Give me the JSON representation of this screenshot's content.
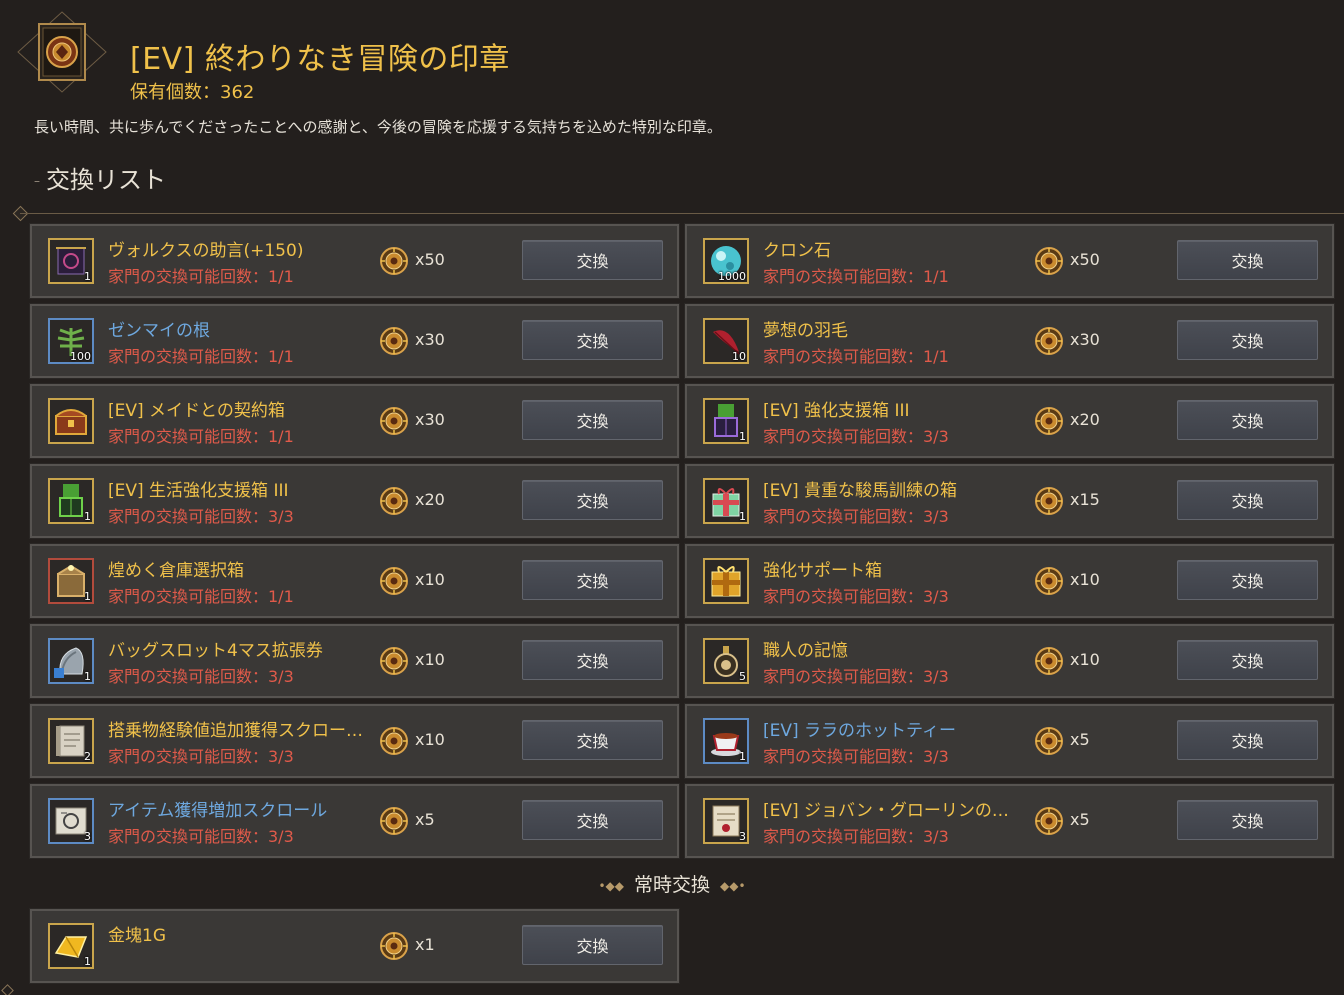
{
  "header": {
    "title": "[EV] 終わりなき冒険の印章",
    "owned_label": "保有個数：362",
    "description": "長い時間、共に歩んでくださったことへの感謝と、今後の冒険を応援する気持ちを込めた特別な印章。",
    "section_title": "交換リスト",
    "section_dash": "–"
  },
  "items": [
    {
      "name": "ヴォルクスの助言(+150)",
      "limit": "家門の交換可能回数：1/1",
      "cost": "x50",
      "qty": "1",
      "button": "交換",
      "icon": "scroll-icon",
      "name_color": "gold"
    },
    {
      "name": "クロン石",
      "limit": "家門の交換可能回数：1/1",
      "cost": "x50",
      "qty": "1000",
      "button": "交換",
      "icon": "cron-stone-icon",
      "name_color": "gold"
    },
    {
      "name": "ゼンマイの根",
      "limit": "家門の交換可能回数：1/1",
      "cost": "x30",
      "qty": "100",
      "button": "交換",
      "icon": "fern-root-icon",
      "name_color": "blue"
    },
    {
      "name": "夢想の羽毛",
      "limit": "家門の交換可能回数：1/1",
      "cost": "x30",
      "qty": "10",
      "button": "交換",
      "icon": "feather-icon",
      "name_color": "gold"
    },
    {
      "name": "[EV] メイドとの契約箱",
      "limit": "家門の交換可能回数：1/1",
      "cost": "x30",
      "qty": "",
      "button": "交換",
      "icon": "chest-icon",
      "name_color": "gold"
    },
    {
      "name": "[EV] 強化支援箱 III",
      "limit": "家門の交換可能回数：3/3",
      "cost": "x20",
      "qty": "1",
      "button": "交換",
      "icon": "purple-box-icon",
      "name_color": "gold"
    },
    {
      "name": "[EV] 生活強化支援箱 III",
      "limit": "家門の交換可能回数：3/3",
      "cost": "x20",
      "qty": "1",
      "button": "交換",
      "icon": "green-box-icon",
      "name_color": "gold"
    },
    {
      "name": "[EV] 貴重な駿馬訓練の箱",
      "limit": "家門の交換可能回数：3/3",
      "cost": "x15",
      "qty": "1",
      "button": "交換",
      "icon": "gift-box-icon",
      "name_color": "gold"
    },
    {
      "name": "煌めく倉庫選択箱",
      "limit": "家門の交換可能回数：1/1",
      "cost": "x10",
      "qty": "1",
      "button": "交換",
      "icon": "storage-box-icon",
      "name_color": "gold"
    },
    {
      "name": "強化サポート箱",
      "limit": "家門の交換可能回数：3/3",
      "cost": "x10",
      "qty": "",
      "button": "交換",
      "icon": "gold-gift-icon",
      "name_color": "gold"
    },
    {
      "name": "バッグスロット4マス拡張券",
      "limit": "家門の交換可能回数：3/3",
      "cost": "x10",
      "qty": "1",
      "button": "交換",
      "icon": "bag-icon",
      "name_color": "gold"
    },
    {
      "name": "職人の記憶",
      "limit": "家門の交換可能回数：3/3",
      "cost": "x10",
      "qty": "5",
      "button": "交換",
      "icon": "bottle-icon",
      "name_color": "gold"
    },
    {
      "name": "搭乗物経験値追加獲得スクロー…",
      "limit": "家門の交換可能回数：3/3",
      "cost": "x10",
      "qty": "2",
      "button": "交換",
      "icon": "mount-scroll-icon",
      "name_color": "gold"
    },
    {
      "name": "[EV] ララのホットティー",
      "limit": "家門の交換可能回数：3/3",
      "cost": "x5",
      "qty": "1",
      "button": "交換",
      "icon": "tea-cup-icon",
      "name_color": "blue"
    },
    {
      "name": "アイテム獲得増加スクロール",
      "limit": "家門の交換可能回数：3/3",
      "cost": "x5",
      "qty": "3",
      "button": "交換",
      "icon": "item-scroll-icon",
      "name_color": "blue"
    },
    {
      "name": "[EV] ジョバン・グローリンの…",
      "limit": "家門の交換可能回数：3/3",
      "cost": "x5",
      "qty": "3",
      "button": "交換",
      "icon": "letter-icon",
      "name_color": "gold"
    }
  ],
  "always_section": {
    "title": "常時交換",
    "orn_left": "•◆◆",
    "orn_right": "◆◆•"
  },
  "always_items": [
    {
      "name": "金塊1G",
      "limit": "",
      "cost": "x1",
      "qty": "1",
      "button": "交換",
      "icon": "gold-bar-icon",
      "name_color": "gold"
    }
  ],
  "colors": {
    "name_gold": "#f0c14a",
    "name_blue": "#6ea8df",
    "limit_red": "#e05a4a",
    "background": "#231f1d",
    "card": "#3a3836"
  }
}
